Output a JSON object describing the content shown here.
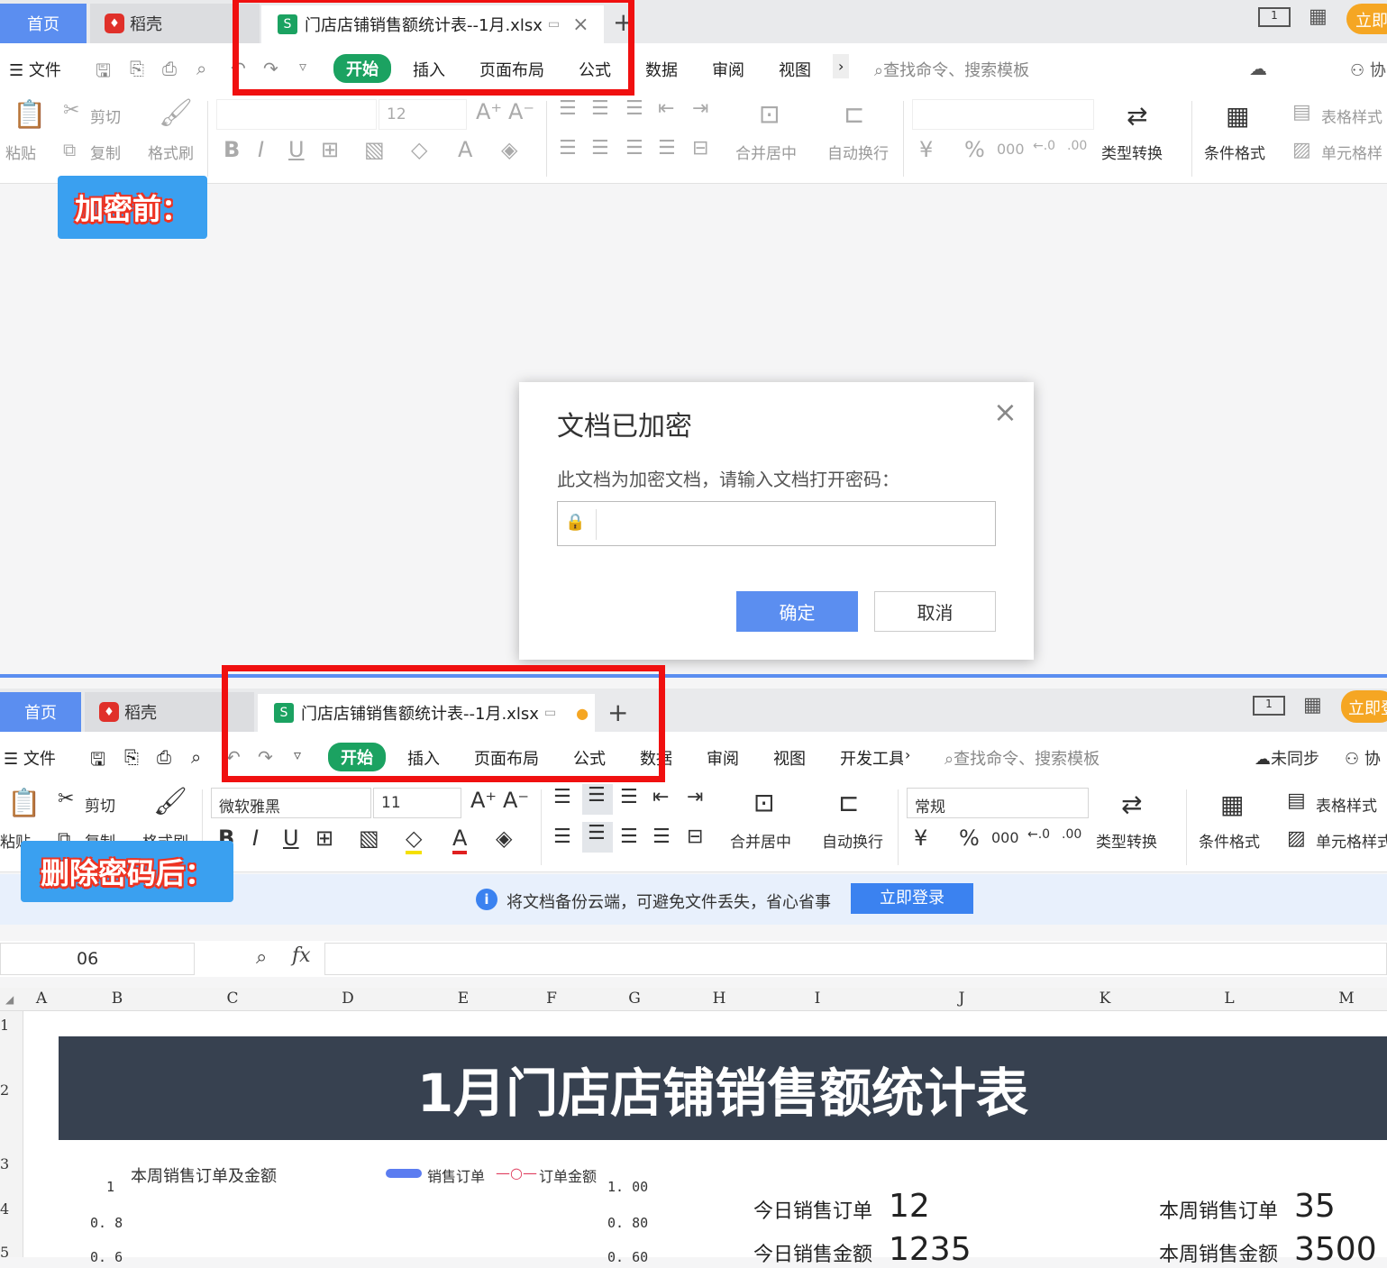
{
  "top": {
    "tabs": {
      "home": "首页",
      "daoke": "稻壳",
      "file": "门店店铺销售额统计表--1月.xlsx",
      "add": "+"
    },
    "right": {
      "login": "立即"
    },
    "menu": {
      "file": "文件",
      "start": "开始",
      "insert": "插入",
      "layout": "页面布局",
      "formula": "公式",
      "data": "数据",
      "review": "审阅",
      "view": "视图",
      "more": "›",
      "search": "查找命令、搜索模板",
      "collab": "协"
    },
    "ribbon": {
      "paste": "粘贴",
      "cut": "剪切",
      "copy": "复制",
      "format_painter": "格式刷",
      "font": "",
      "font_size": "12",
      "merge": "合并居中",
      "wrap": "自动换行",
      "numfmt": "",
      "convert": "类型转换",
      "cond": "条件格式",
      "table_style": "表格样式",
      "cell_style": "单元格样"
    }
  },
  "label_before": "加密前：",
  "dialog": {
    "title": "文档已加密",
    "message": "此文档为加密文档，请输入文档打开密码：",
    "password": "",
    "ok": "确定",
    "cancel": "取消",
    "close": "×"
  },
  "bottom": {
    "tabs": {
      "home": "首页",
      "daoke": "稻壳",
      "file": "门店店铺销售额统计表--1月.xlsx",
      "add": "+"
    },
    "right": {
      "login": "立即登"
    },
    "menu": {
      "file": "文件",
      "start": "开始",
      "insert": "插入",
      "layout": "页面布局",
      "formula": "公式",
      "data": "数据",
      "review": "审阅",
      "view": "视图",
      "dev": "开发工具",
      "more": "›",
      "search": "查找命令、搜索模板",
      "sync": "未同步",
      "collab": "协"
    },
    "ribbon": {
      "paste": "粘贴",
      "cut": "剪切",
      "copy": "复制",
      "format_painter": "格式刷",
      "font": "微软雅黑",
      "font_size": "11",
      "merge": "合并居中",
      "wrap": "自动换行",
      "numfmt": "常规",
      "convert": "类型转换",
      "cond": "条件格式",
      "table_style": "表格样式",
      "cell_style": "单元格样式"
    },
    "cloud_msg": "将文档备份云端，可避免文件丢失，省心省事",
    "cloud_login": "立即登录",
    "namebox": "06",
    "fx": "fx",
    "columns": [
      "A",
      "B",
      "C",
      "D",
      "E",
      "F",
      "G",
      "H",
      "I",
      "J",
      "K",
      "L",
      "M"
    ],
    "rows": [
      "1",
      "2",
      "3",
      "4",
      "5"
    ],
    "sheet_title": "1月门店店铺销售额统计表",
    "chart_title": "本周销售订单及金额",
    "legend1": "销售订单",
    "legend2": "订单金额",
    "axis_left": [
      "1",
      "0. 8",
      "0. 6"
    ],
    "axis_right": [
      "1. 00",
      "0. 80",
      "0. 60"
    ],
    "kpis": [
      {
        "label": "今日销售订单",
        "value": "12"
      },
      {
        "label": "今日销售金额",
        "value": "1235"
      },
      {
        "label": "本周销售订单",
        "value": "35"
      },
      {
        "label": "本周销售金额",
        "value": "3500"
      }
    ]
  },
  "label_after": "删除密码后："
}
